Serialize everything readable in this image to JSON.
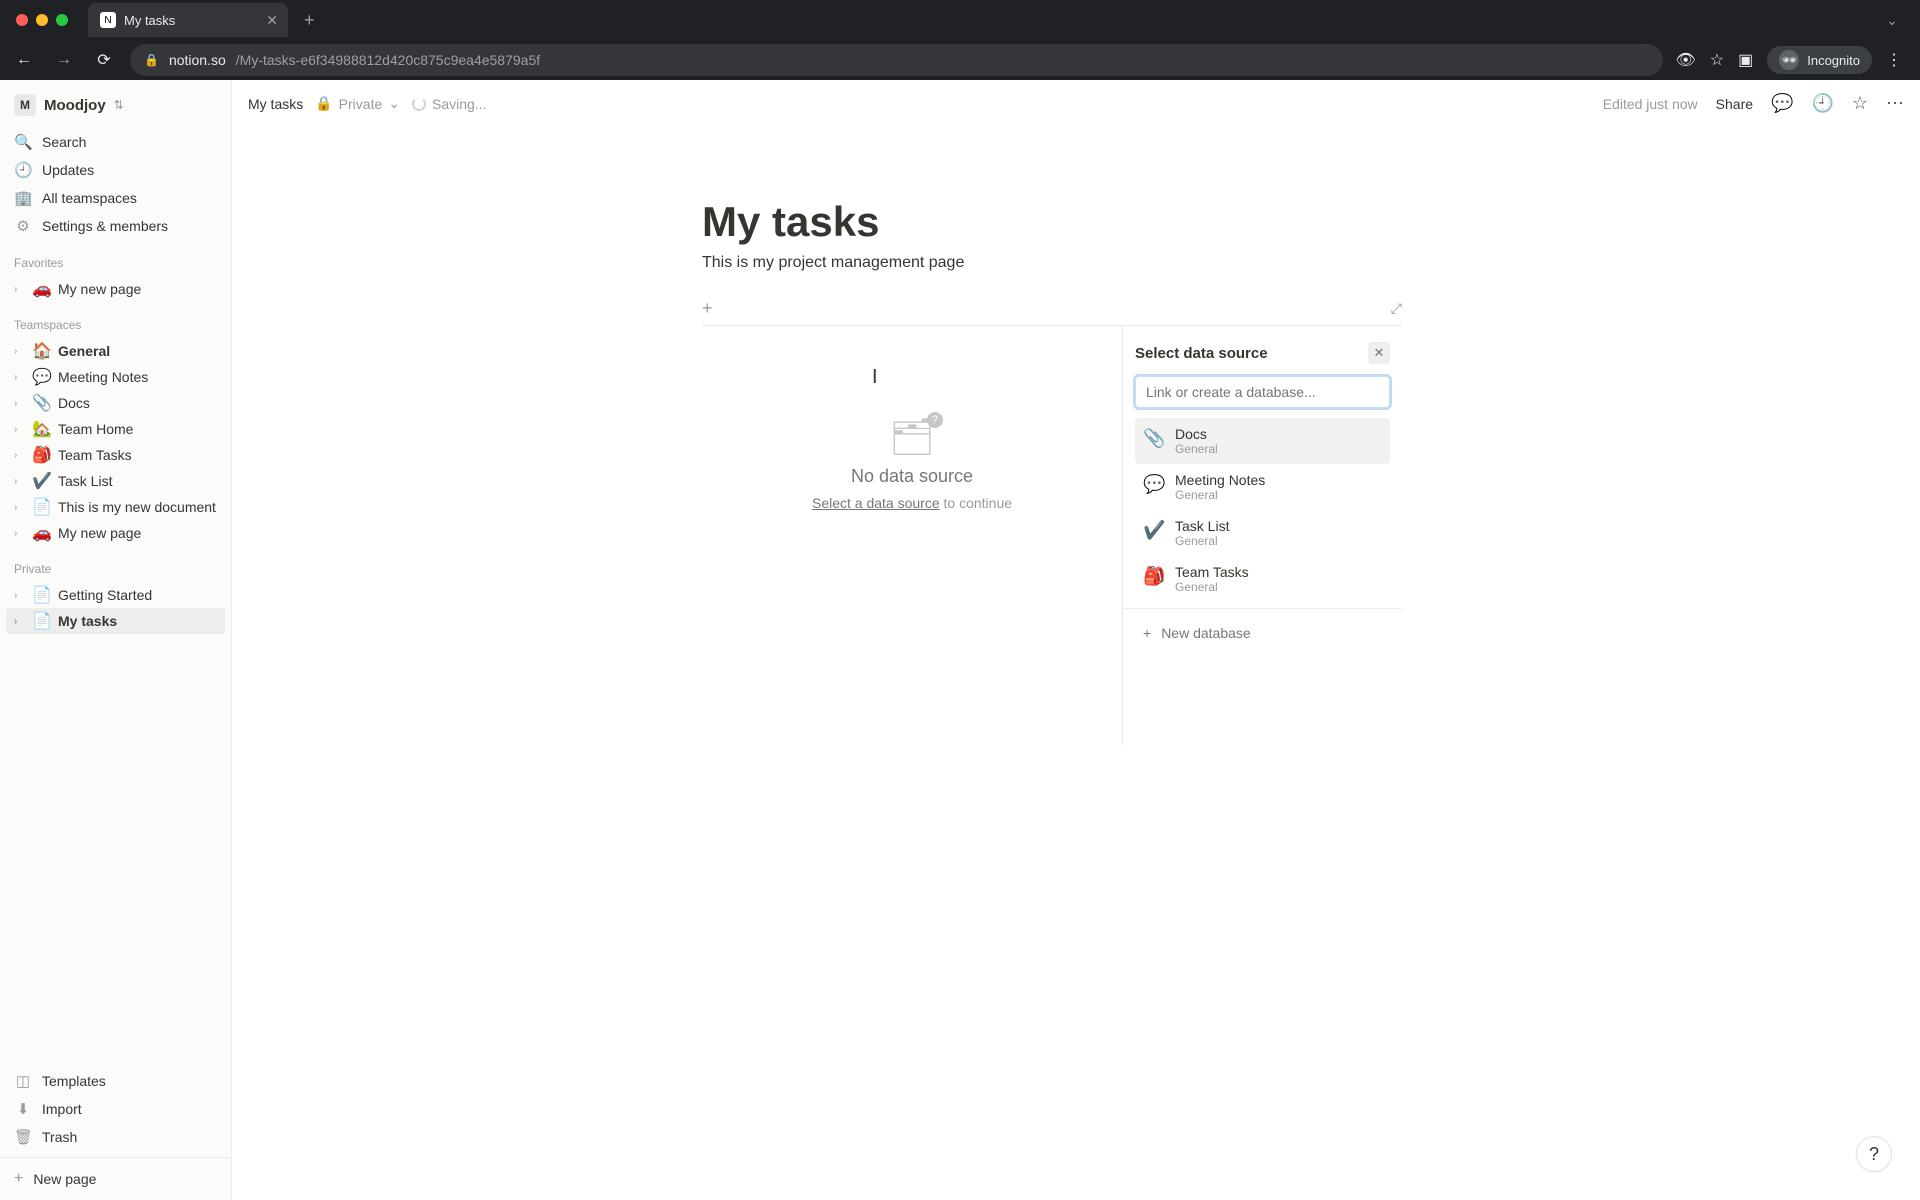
{
  "browser": {
    "tab_title": "My tasks",
    "url_host": "notion.so",
    "url_path": "/My-tasks-e6f34988812d420c875c9ea4e5879a5f",
    "incognito_label": "Incognito"
  },
  "workspace": {
    "initial": "M",
    "name": "Moodjoy"
  },
  "sidebar_nav": {
    "search": "Search",
    "updates": "Updates",
    "all_teamspaces": "All teamspaces",
    "settings_members": "Settings & members"
  },
  "sidebar_sections": {
    "favorites_label": "Favorites",
    "teamspaces_label": "Teamspaces",
    "private_label": "Private"
  },
  "favorites": [
    {
      "emoji": "🚗",
      "title": "My new page"
    }
  ],
  "teamspaces": [
    {
      "emoji": "🏠",
      "title": "General",
      "bold": true
    },
    {
      "emoji": "💬",
      "title": "Meeting Notes"
    },
    {
      "emoji": "📎",
      "title": "Docs"
    },
    {
      "emoji": "🏡",
      "title": "Team Home"
    },
    {
      "emoji": "🎒",
      "title": "Team Tasks"
    },
    {
      "emoji": "✔️",
      "title": "Task List"
    },
    {
      "emoji": "📄",
      "title": "This is my new document"
    },
    {
      "emoji": "🚗",
      "title": "My new page"
    }
  ],
  "private_pages": [
    {
      "emoji": "📄",
      "title": "Getting Started"
    },
    {
      "emoji": "📄",
      "title": "My tasks",
      "active": true
    }
  ],
  "sidebar_bottom": {
    "templates": "Templates",
    "import": "Import",
    "trash": "Trash",
    "new_page": "New page"
  },
  "topbar": {
    "breadcrumb": "My tasks",
    "privacy": "Private",
    "saving": "Saving...",
    "edited": "Edited just now",
    "share": "Share"
  },
  "page": {
    "title": "My tasks",
    "description": "This is my project management page"
  },
  "empty_state": {
    "title": "No data source",
    "link_text": "Select a data source",
    "suffix": " to continue"
  },
  "popover": {
    "title": "Select data source",
    "search_placeholder": "Link or create a database...",
    "options": [
      {
        "icon": "📎",
        "title": "Docs",
        "subtitle": "General",
        "hover": true
      },
      {
        "icon": "💬",
        "title": "Meeting Notes",
        "subtitle": "General"
      },
      {
        "icon": "✔️",
        "title": "Task List",
        "subtitle": "General"
      },
      {
        "icon": "🎒",
        "title": "Team Tasks",
        "subtitle": "General"
      }
    ],
    "new_database": "New database"
  },
  "help_label": "?"
}
